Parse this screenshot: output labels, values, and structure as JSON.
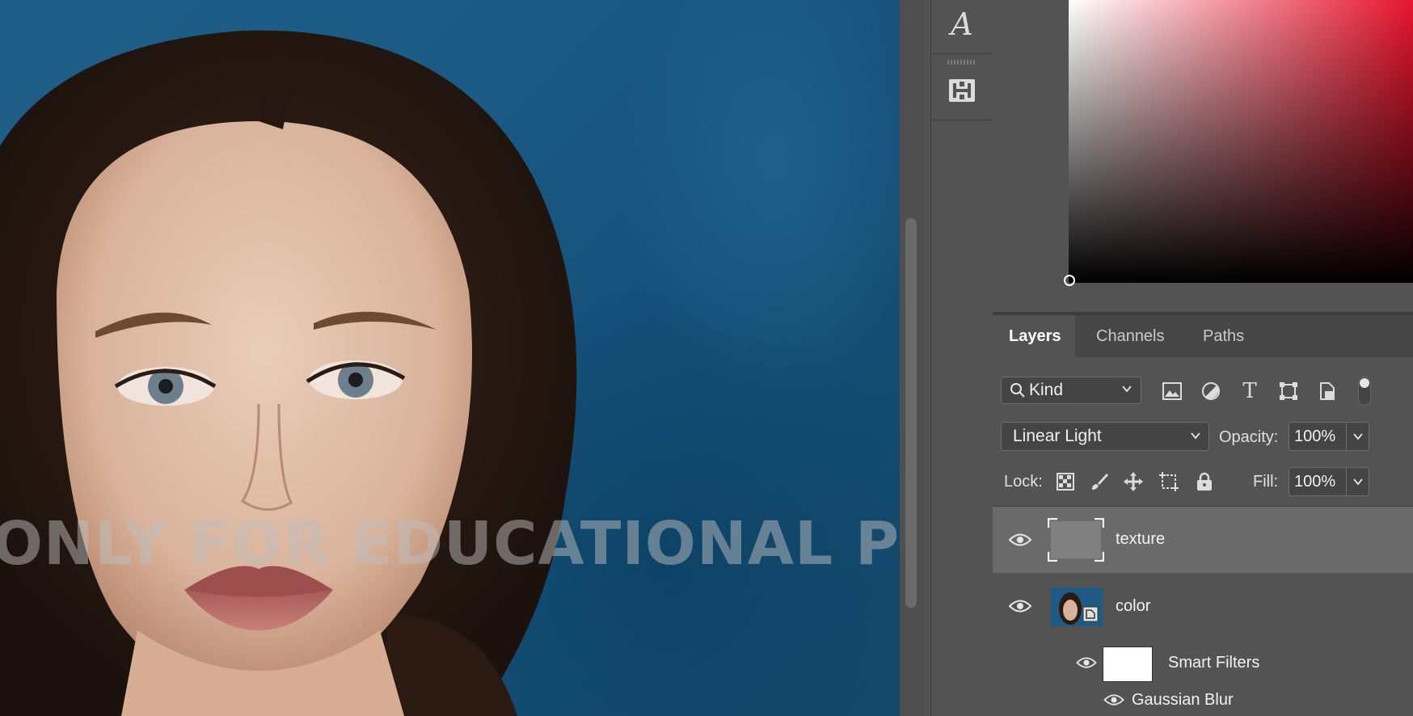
{
  "canvas": {
    "watermark_text": "ONLY FOR EDUCATIONAL PURP",
    "photo_description_icon": "portrait-photo"
  },
  "toolstrip": {
    "items": [
      {
        "icon": "character-A-icon"
      },
      {
        "icon": "glyphs-grid-icon"
      }
    ]
  },
  "color_picker": {
    "hue_color": "#e8152f"
  },
  "layers_panel": {
    "tabs": [
      {
        "label": "Layers",
        "active": true
      },
      {
        "label": "Channels",
        "active": false
      },
      {
        "label": "Paths",
        "active": false
      }
    ],
    "filter": {
      "kind_label": "Kind",
      "icons": [
        "pixel-filter-icon",
        "adjustment-filter-icon",
        "type-filter-icon",
        "shape-filter-icon",
        "smart-object-filter-icon"
      ]
    },
    "blend_mode": "Linear Light",
    "opacity_label": "Opacity:",
    "opacity_value": "100%",
    "lock_label": "Lock:",
    "fill_label": "Fill:",
    "fill_value": "100%",
    "layers": [
      {
        "name": "texture",
        "selected": true,
        "visible": true
      },
      {
        "name": "color",
        "selected": false,
        "visible": true
      },
      {
        "name": "Smart Filters",
        "selected": false,
        "visible": true
      },
      {
        "name": "Gaussian Blur",
        "selected": false,
        "visible": true
      }
    ]
  }
}
